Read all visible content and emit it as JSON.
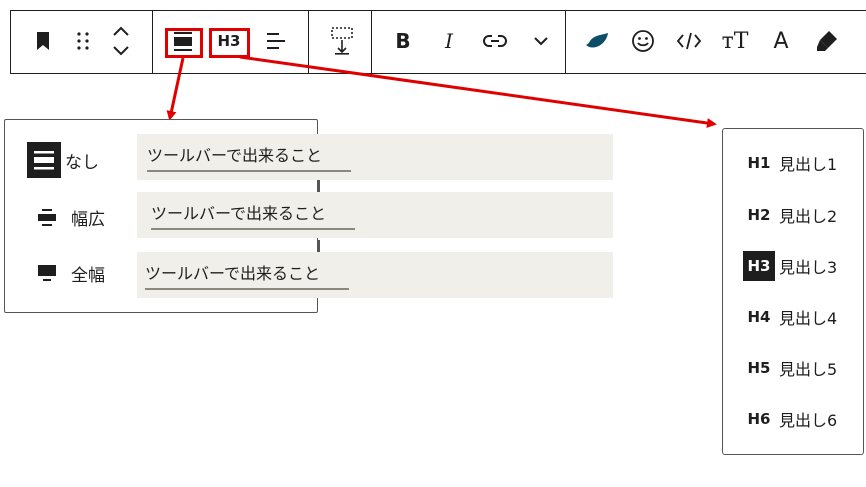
{
  "toolbar": {
    "group1": [
      {
        "icon": "bookmark-icon"
      },
      {
        "icon": "drag-handle-icon"
      },
      {
        "icon": "move-up-down-icon"
      }
    ],
    "align_icon": "align-none-icon",
    "heading_level_label": "H3",
    "text_align_icon": "text-align-left-icon",
    "spacing_icon": "spacing-icon",
    "bold_label": "B",
    "italic_label": "I",
    "more_tools_icon": "chevron-down-icon",
    "font_glyph_serif": "тT",
    "font_glyph_letter": "A"
  },
  "alignment_popover": {
    "options": [
      {
        "icon": "align-none-icon",
        "label": "なし",
        "sample": "ツールバーで出来ること"
      },
      {
        "icon": "align-wide-icon",
        "label": "幅広",
        "sample": "ツールバーで出来ること"
      },
      {
        "icon": "align-full-icon",
        "label": "全幅",
        "sample": "ツールバーで出来ること"
      }
    ]
  },
  "heading_popover": {
    "items": [
      {
        "tag": "H1",
        "label": "見出し1",
        "active": false
      },
      {
        "tag": "H2",
        "label": "見出し2",
        "active": false
      },
      {
        "tag": "H3",
        "label": "見出し3",
        "active": true
      },
      {
        "tag": "H4",
        "label": "見出し4",
        "active": false
      },
      {
        "tag": "H5",
        "label": "見出し5",
        "active": false
      },
      {
        "tag": "H6",
        "label": "見出し6",
        "active": false
      }
    ]
  },
  "colors": {
    "highlight": "#e00000",
    "text": "#1e1e1e",
    "sample_bg": "#f0efe9",
    "active_bg": "#1e1e1e"
  }
}
